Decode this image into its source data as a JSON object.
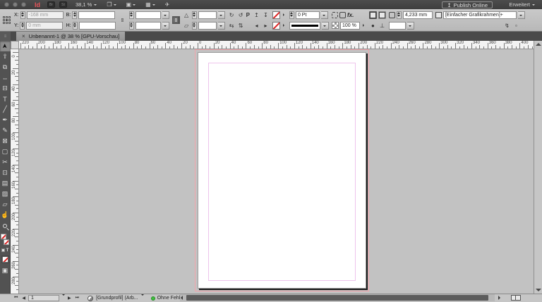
{
  "app_bar": {
    "logo": "Id",
    "bridge_label": "Br",
    "stock_label": "St",
    "zoom_value": "38,1 %",
    "publish_icon": "↥",
    "publish_label": "Publish Online",
    "workspace_label": "Erweitert",
    "view_options_glyph": "❒",
    "screen_mode_glyph": "▣",
    "arrange_glyph": "▦",
    "gpu_glyph": "✈"
  },
  "control_panel": {
    "x_label": "X:",
    "x_value": "-168 mm",
    "y_label": "Y:",
    "y_value": "0 mm",
    "w_label": "B:",
    "w_value": "",
    "h_label": "H:",
    "h_value": "",
    "scale_x_value": "",
    "scale_y_value": "",
    "constrain_glyph": "∞",
    "rotation_glyph": "△",
    "rotation_value": "",
    "shear_glyph": "▱",
    "shear_value": "",
    "rotate_cw_glyph": "↻",
    "rotate_ccw_glyph": "↺",
    "flip_h_glyph": "⇆",
    "flip_v_glyph": "⇅",
    "flip_preview": "P",
    "select_container_glyph": "↥",
    "select_content_glyph": "↧",
    "select_prev_glyph": "◂",
    "select_next_glyph": "▸",
    "stroke_weight_value": "0 Pt",
    "effects_label": "fx.",
    "opacity_value": "100 %",
    "corner_radius_value": "4,233 mm",
    "object_style_value": "[Einfacher Grafikrahmen]+",
    "quick_apply_glyph": "↯",
    "panel_options_glyph": "▫"
  },
  "document_tab": {
    "close_glyph": "×",
    "title": "Unbenannt-1 @ 38 % [GPU-Vorschau]"
  },
  "tools": [
    {
      "name": "selection-tool",
      "glyph": "➤",
      "rotate": -90,
      "active": true
    },
    {
      "name": "direct-selection-tool",
      "glyph": "⇧",
      "rotate": 0,
      "active": false
    },
    {
      "name": "page-tool",
      "glyph": "⧉",
      "rotate": 0,
      "active": false
    },
    {
      "name": "gap-tool",
      "glyph": "⇔",
      "rotate": 0,
      "active": false
    },
    {
      "name": "content-collector-tool",
      "glyph": "⊟",
      "rotate": 0,
      "active": false
    },
    {
      "name": "type-tool",
      "glyph": "T",
      "rotate": 0,
      "active": false
    },
    {
      "name": "line-tool",
      "glyph": "╱",
      "rotate": 0,
      "active": false
    },
    {
      "name": "pen-tool",
      "glyph": "✒",
      "rotate": 0,
      "active": false
    },
    {
      "name": "pencil-tool",
      "glyph": "✎",
      "rotate": 0,
      "active": false
    },
    {
      "name": "rectangle-frame-tool",
      "glyph": "⊠",
      "rotate": 0,
      "active": false
    },
    {
      "name": "rectangle-tool",
      "glyph": "▢",
      "rotate": 0,
      "active": false
    },
    {
      "name": "scissors-tool",
      "glyph": "✂",
      "rotate": 0,
      "active": false
    },
    {
      "name": "free-transform-tool",
      "glyph": "⊡",
      "rotate": 0,
      "active": false
    },
    {
      "name": "gradient-swatch-tool",
      "glyph": "▤",
      "rotate": 0,
      "active": false
    },
    {
      "name": "gradient-feather-tool",
      "glyph": "▨",
      "rotate": 0,
      "active": false
    },
    {
      "name": "note-tool",
      "glyph": "▱",
      "rotate": 0,
      "active": false
    },
    {
      "name": "hand-tool",
      "glyph": "☝",
      "rotate": 0,
      "active": false
    },
    {
      "name": "zoom-tool",
      "glyph": "css-zoom",
      "rotate": 0,
      "active": false
    }
  ],
  "rulers": {
    "horizontal_values": [
      -220,
      -200,
      -180,
      -160,
      -140,
      -120,
      -100,
      -80,
      -60,
      -40,
      -20,
      0,
      20,
      40,
      60,
      80,
      100,
      120,
      140,
      160,
      180,
      200,
      220,
      240,
      260,
      280,
      300,
      320,
      340,
      360,
      380,
      400
    ],
    "vertical_values": [
      0,
      20,
      40,
      60,
      80,
      100,
      120,
      140,
      160,
      180,
      200,
      220,
      240,
      260,
      280
    ]
  },
  "canvas": {
    "pasteboard_color": "#c2c2c2",
    "page_color": "#ffffff",
    "margin_guide_color": "#eec4ec",
    "bleed_guide_color": "#f2a3ab"
  },
  "status_bar": {
    "first_page_glyph": "⏮",
    "prev_page_glyph": "◀",
    "page_value": "1",
    "next_page_glyph": "▶",
    "last_page_glyph": "⏭",
    "preflight_profile": "[Grundprofil] (Arb...",
    "status_text": "Ohne Fehler"
  }
}
